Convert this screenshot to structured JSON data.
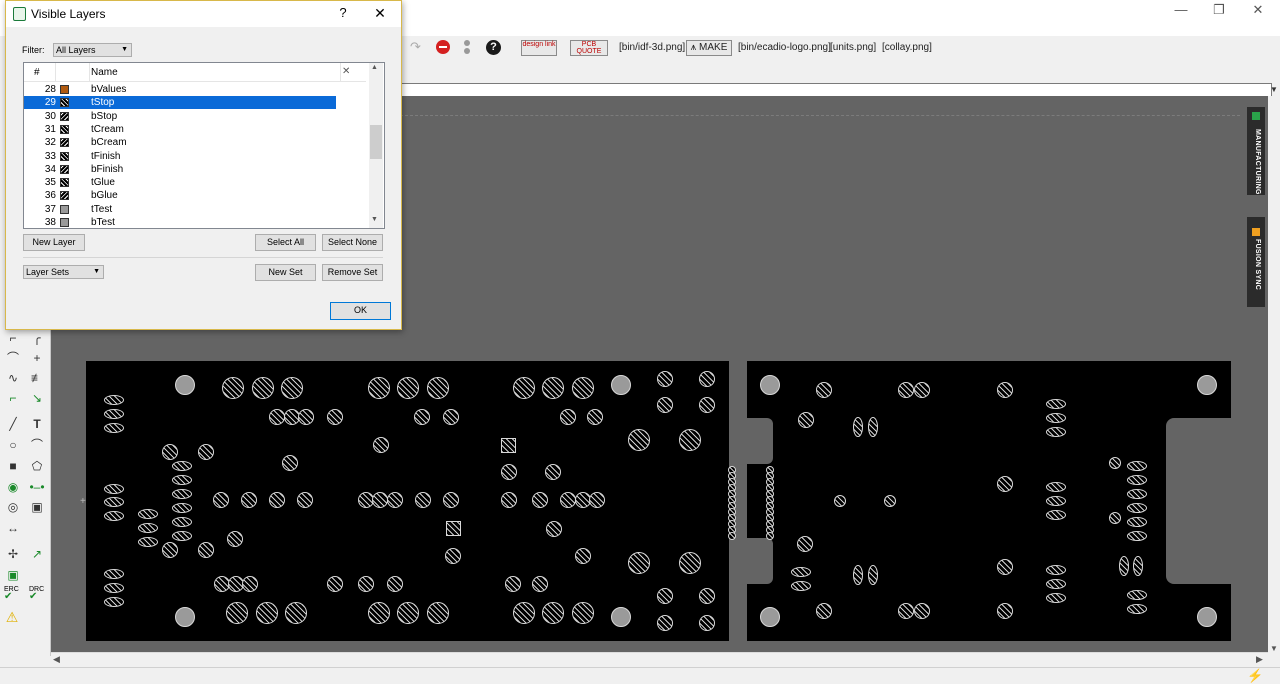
{
  "app": {
    "window_controls": {
      "minimize": "—",
      "restore": "❐",
      "close": "✕"
    }
  },
  "toolbar": {
    "items": [
      "[bin/idf-3d.png]",
      "MAKE",
      "[bin/ecadio-logo.png]",
      "[units.png]",
      "[collay.png]"
    ],
    "design_link": "design link",
    "pcb_quote": "PCB QUOTE"
  },
  "side_tabs": {
    "manufacturing": "MANUFACTURING",
    "fusion_sync": "FUSION SYNC"
  },
  "left_tools": {
    "erc": "ERC",
    "drc": "DRC"
  },
  "dialog": {
    "title": "Visible Layers",
    "help": "?",
    "close": "✕",
    "filter_label": "Filter:",
    "filter_value": "All Layers",
    "columns": {
      "num": "#",
      "name": "Name",
      "clear": "✕"
    },
    "layers": [
      {
        "num": "28",
        "name": "bValues",
        "color": "#b05a10",
        "pattern": "solid"
      },
      {
        "num": "29",
        "name": "tStop",
        "color": "#333333",
        "pattern": "hatch",
        "selected": true
      },
      {
        "num": "30",
        "name": "bStop",
        "color": "#333333",
        "pattern": "hatchb"
      },
      {
        "num": "31",
        "name": "tCream",
        "color": "#333333",
        "pattern": "hatch"
      },
      {
        "num": "32",
        "name": "bCream",
        "color": "#333333",
        "pattern": "hatchb"
      },
      {
        "num": "33",
        "name": "tFinish",
        "color": "#333333",
        "pattern": "hatch"
      },
      {
        "num": "34",
        "name": "bFinish",
        "color": "#333333",
        "pattern": "hatchb"
      },
      {
        "num": "35",
        "name": "tGlue",
        "color": "#333333",
        "pattern": "hatch"
      },
      {
        "num": "36",
        "name": "bGlue",
        "color": "#333333",
        "pattern": "hatchb"
      },
      {
        "num": "37",
        "name": "tTest",
        "color": "#9a9a9a",
        "pattern": "solid"
      },
      {
        "num": "38",
        "name": "bTest",
        "color": "#9a9a9a",
        "pattern": "solid"
      }
    ],
    "buttons": {
      "new_layer": "New Layer",
      "select_all": "Select All",
      "select_none": "Select None",
      "new_set": "New Set",
      "remove_set": "Remove Set",
      "ok": "OK"
    },
    "layer_sets": "Layer Sets"
  }
}
